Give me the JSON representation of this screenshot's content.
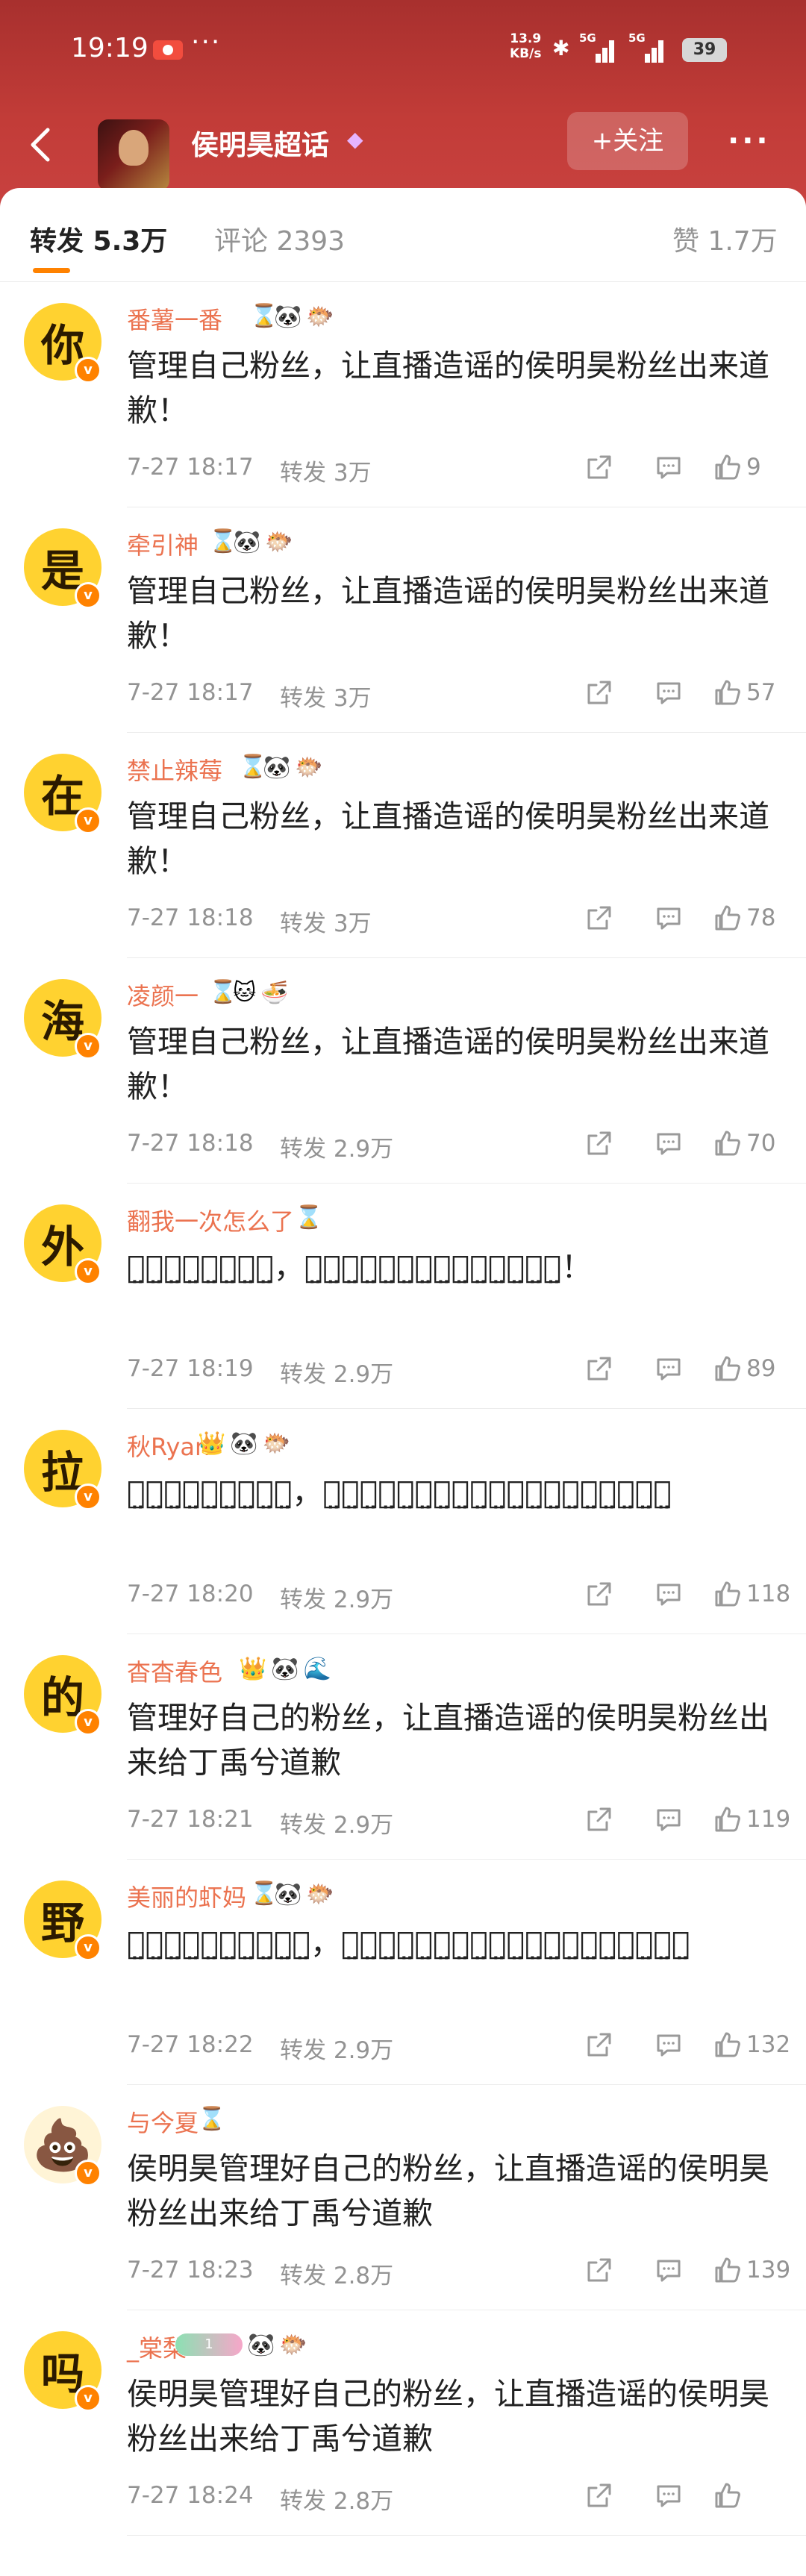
{
  "status_bar": {
    "time": "19:19",
    "more": "···",
    "net_speed": "13.9\nKB/s",
    "signal_1": "5G",
    "signal_2": "5G",
    "battery": "39"
  },
  "nav": {
    "title": "侯明昊超话",
    "follow_label": "+关注",
    "more_icon": "···"
  },
  "tabs": [
    {
      "label": "转发 5.3万",
      "active": true
    },
    {
      "label": "评论 2393",
      "active": false
    },
    {
      "label": "赞 1.7万",
      "active": false
    }
  ],
  "comments": [
    {
      "avatar": "你",
      "name": "番薯一番",
      "badges": [
        "hourglass",
        "panda",
        "fish"
      ],
      "text": "管理自己粉丝，让直播造谣的侯明昊粉丝出来道歉！",
      "time": "7-27 18:17",
      "repost": "转发 3万",
      "likes": "9"
    },
    {
      "avatar": "是",
      "name": "牵引神",
      "badges": [
        "hourglass",
        "panda",
        "fish"
      ],
      "text": "管理自己粉丝，让直播造谣的侯明昊粉丝出来道歉！",
      "time": "7-27 18:17",
      "repost": "转发 3万",
      "likes": "57"
    },
    {
      "avatar": "在",
      "name": "禁止辣莓",
      "badges": [
        "hourglass",
        "panda",
        "fish"
      ],
      "text": "管理自己粉丝，让直播造谣的侯明昊粉丝出来道歉！",
      "time": "7-27 18:18",
      "repost": "转发 3万",
      "likes": "78"
    },
    {
      "avatar": "海",
      "name": "凌颜一",
      "badges": [
        "hourglass",
        "cat",
        "noodles"
      ],
      "text": "管理自己粉丝，让直播造谣的侯明昊粉丝出来道歉！",
      "time": "7-27 18:18",
      "repost": "转发 2.9万",
      "likes": "70"
    },
    {
      "avatar": "外",
      "name": "翻我一次怎么了",
      "badges": [
        "hourglass"
      ],
      "text": "侯̤明̤昊̤管̤理̤好̤粉̤丝̤，直̤播̤造̤谣̤的̤侯̤明̤昊̤粉̤丝̤出̤来̤道̤歉̤！",
      "time": "7-27 18:19",
      "repost": "转发 2.9万",
      "likes": "89"
    },
    {
      "avatar": "拉",
      "name": "秋Ryan",
      "badges": [
        "crown",
        "panda",
        "fish"
      ],
      "text": "侯̤明̤昊̤管̤理̤自̤己̤粉̤丝̤，让̤直̤播̤造̤谣̤的̤侯̤明̤昊̤粉̤丝̤出̤来̤给̤丁̤禹̤兮̤道̤歉̤",
      "time": "7-27 18:20",
      "repost": "转发 2.9万",
      "likes": "118"
    },
    {
      "avatar": "的",
      "name": "杳杳春色",
      "badges": [
        "crown",
        "panda",
        "wave"
      ],
      "text": "管理好自己的粉丝，让直播造谣的侯明昊粉丝出来给丁禹兮道歉",
      "time": "7-27 18:21",
      "repost": "转发 2.9万",
      "likes": "119"
    },
    {
      "avatar": "野",
      "name": "美丽的虾妈",
      "badges": [
        "hourglass",
        "panda",
        "fish"
      ],
      "text": "侯̤明̤昊̤管̤理̤好̤自̤己̤粉̤丝̤，让̤直̤播̤造̤谣̤的̤侯̤明̤昊̤粉̤丝̤出̤来̤给̤丁̤禹̤兮̤道̤歉̤",
      "time": "7-27 18:22",
      "repost": "转发 2.9万",
      "likes": "132"
    },
    {
      "avatar": "💩",
      "name": "与今夏",
      "badges": [
        "hourglass"
      ],
      "text": "侯明昊管理好自己的粉丝，让直播造谣的侯明昊粉丝出来给丁禹兮道歉",
      "time": "7-27 18:23",
      "repost": "转发 2.8万",
      "likes": "139"
    },
    {
      "avatar": "吗",
      "name": "_棠梨",
      "badges": [
        "pill",
        "panda",
        "fish"
      ],
      "text": "侯明昊管理好自己的粉丝，让直播造谣的侯明昊粉丝出来给丁禹兮道歉",
      "time": "7-27 18:24",
      "repost": "转发 2.8万",
      "likes": ""
    }
  ],
  "badge_glyphs": {
    "hourglass": "⌛",
    "panda": "🐼",
    "fish": "🐡",
    "cat": "🐱",
    "noodles": "🍜",
    "crown": "👑",
    "wave": "🌊",
    "pill": "1"
  },
  "colors": {
    "header_red": "#c23c38",
    "username": "#eb7350",
    "accent": "#ff8200",
    "avatar_yellow": "#ffd230",
    "meta_gray": "#939393"
  }
}
